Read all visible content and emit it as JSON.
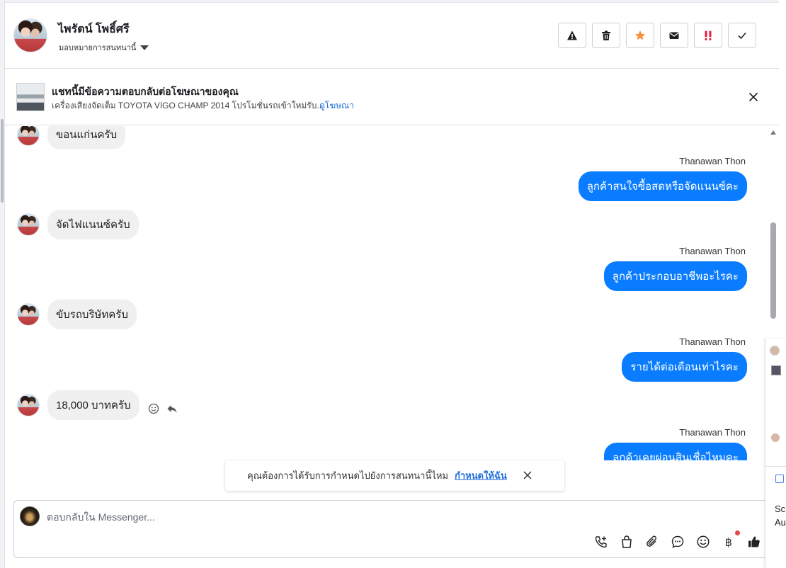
{
  "header": {
    "contact_name": "ไพรัตน์ โพธิ์ศรี",
    "assign_label": "มอบหมายการสนทนานี้",
    "actions": [
      {
        "name": "spam-button",
        "icon": "warning-icon"
      },
      {
        "name": "delete-button",
        "icon": "trash-icon"
      },
      {
        "name": "star-button",
        "icon": "star-icon"
      },
      {
        "name": "mark-unread-button",
        "icon": "envelope-icon"
      },
      {
        "name": "follow-up-button",
        "icon": "double-exclamation-icon"
      },
      {
        "name": "mark-done-button",
        "icon": "check-icon"
      }
    ]
  },
  "ad_banner": {
    "title": "แชทนี้มีข้อความตอบกลับต่อโฆษณาของคุณ",
    "description": "เครื่องเสียงจัดเต็ม TOYOTA VIGO CHAMP 2014 โปรโมชั่นรถเข้าใหม่รับ...",
    "link": "ดูโฆษณา"
  },
  "messages": [
    {
      "direction": "in",
      "text": "ขอนแก่นครับ"
    },
    {
      "direction": "out",
      "sender": "Thanawan Thon",
      "text": "ลูกค้าสนใจซื้อสดหรือจัดแนนซ์คะ"
    },
    {
      "direction": "in",
      "text": "จัดไฟแนนซ์ครับ"
    },
    {
      "direction": "out",
      "sender": "Thanawan Thon",
      "text": "ลูกค้าประกอบอาชีพอะไรคะ"
    },
    {
      "direction": "in",
      "text": "ขับรถบริษัทครับ"
    },
    {
      "direction": "out",
      "sender": "Thanawan Thon",
      "text": "รายได้ต่อเดือนเท่าไรคะ"
    },
    {
      "direction": "in",
      "text": "18,000 บาทครับ"
    },
    {
      "direction": "out",
      "sender": "Thanawan Thon",
      "text": "ลูกค้าเคยผ่อนสินเชื่อไหมคะ"
    }
  ],
  "toast": {
    "text": "คุณต้องการได้รับการกำหนดไปยังการสนทนานี้ไหม",
    "link": "กำหนดให้ฉัน"
  },
  "composer": {
    "placeholder": "ตอบกลับใน Messenger...",
    "tools": [
      "phone-plus-icon",
      "shopping-bag-icon",
      "paperclip-icon",
      "chat-bubble-icon",
      "emoji-icon",
      "baht-icon",
      "thumbs-up-icon"
    ],
    "baht_symbol": "฿"
  },
  "side_panel": {
    "line1": "Sc",
    "line2": "Au"
  },
  "colors": {
    "outgoing_bubble": "#0a7cff",
    "incoming_bubble": "#f0f0f0",
    "link": "#216fdb",
    "star": "#f7923a",
    "follow_up": "#e41e3f"
  }
}
